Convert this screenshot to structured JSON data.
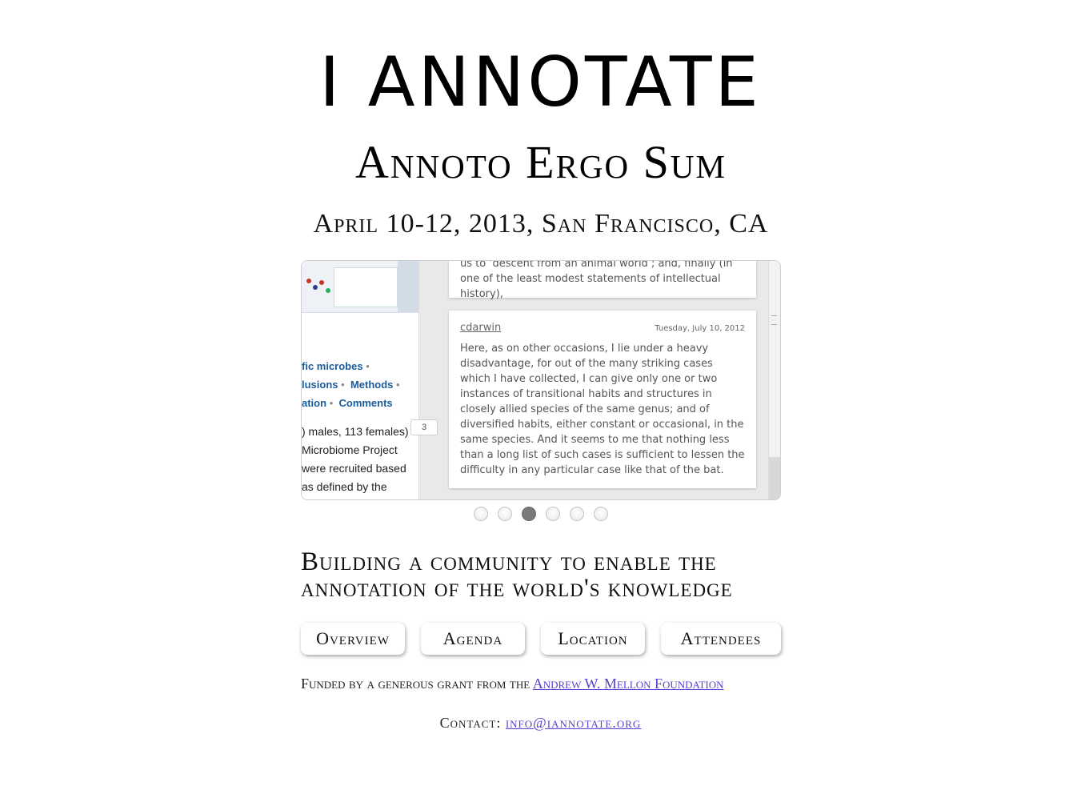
{
  "header": {
    "title": "I ANNOTATE",
    "subtitle": "Annoto Ergo Sum",
    "dates": "April 10-12, 2013, San Francisco, CA"
  },
  "slideshow": {
    "left_panel": {
      "links_line1": "fic microbes",
      "links_line2_a": "lusions",
      "links_line2_b": "Methods",
      "links_line3_a": "ation",
      "links_line3_b": "Comments",
      "body_lines": [
        ") males, 113 females)",
        "Microbiome Project",
        "were recruited based",
        "as defined by the"
      ],
      "marker_count": "3"
    },
    "top_card_text": "us to ‘descent from an animal world’; and, finally (in one of the least modest statements of intellectual history),",
    "annotation": {
      "user": "cdarwin",
      "date": "Tuesday, July 10, 2012",
      "body": "Here, as on other occasions, I lie under a heavy disadvantage, for out of the many striking cases which I have collected, I can give only one or two instances of transitional habits and structures in closely allied species of the same genus; and of diversified habits, either constant or occasional, in the same species. And it seems to me that nothing less than a long list of such cases is sufficient to lessen the difficulty in any particular case like that of the bat."
    },
    "dots_total": 6,
    "active_dot": 3
  },
  "tagline": "Building a community to enable the annotation of the world's knowledge",
  "nav": {
    "overview": "Overview",
    "agenda": "Agenda",
    "location": "Location",
    "attendees": "Attendees"
  },
  "footer": {
    "funded_prefix": "Funded by a generous grant from the",
    "funder_link": "Andrew W. Mellon Foundation",
    "contact_label": "Contact:",
    "contact_email": "info@iannotate.org"
  },
  "colors": {
    "link": "#5a3fd0",
    "left_link_blue": "#1a5c9c",
    "active_dot": "#7a7a7a"
  }
}
